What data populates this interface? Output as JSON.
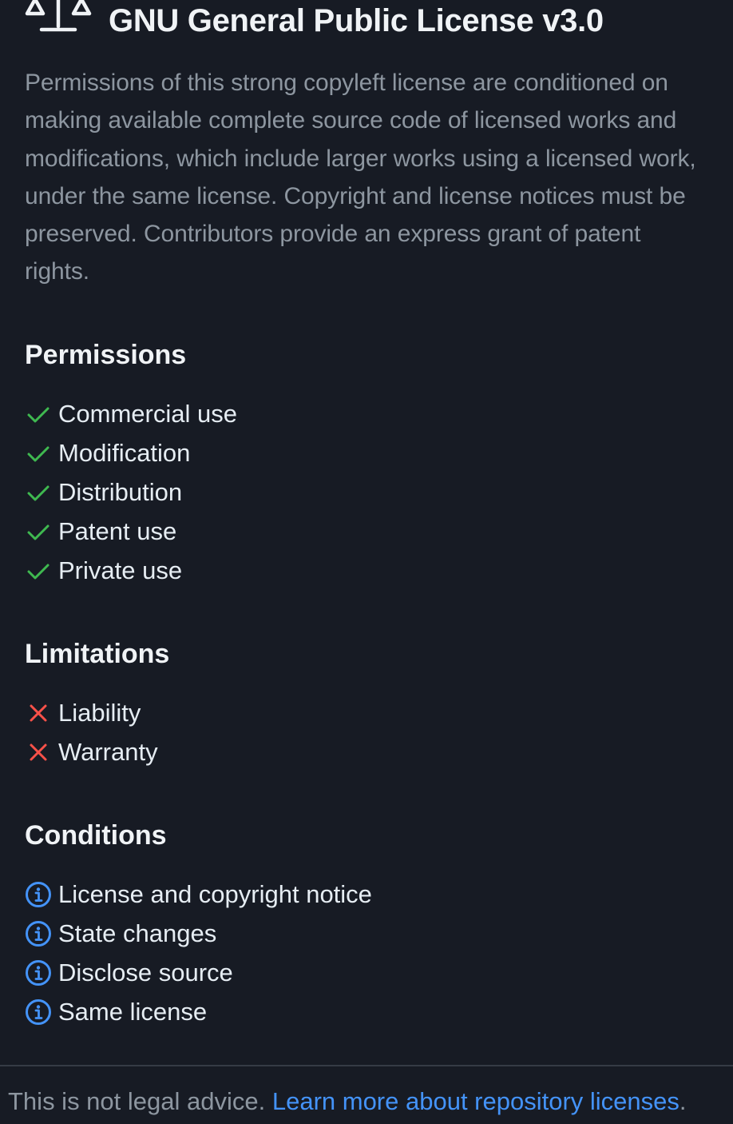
{
  "license": {
    "icon": "law-icon",
    "title": "GNU General Public License v3.0",
    "description": "Permissions of this strong copyleft license are conditioned on making available complete source code of licensed works and modifications, which include larger works using a licensed work, under the same license. Copyright and license notices must be preserved. Contributors provide an express grant of patent rights."
  },
  "permissions": {
    "heading": "Permissions",
    "icon": "check-icon",
    "color": "#3fb950",
    "items": [
      "Commercial use",
      "Modification",
      "Distribution",
      "Patent use",
      "Private use"
    ]
  },
  "limitations": {
    "heading": "Limitations",
    "icon": "x-icon",
    "color": "#f85149",
    "items": [
      "Liability",
      "Warranty"
    ]
  },
  "conditions": {
    "heading": "Conditions",
    "icon": "info-icon",
    "color": "#4493f8",
    "items": [
      "License and copyright notice",
      "State changes",
      "Disclose source",
      "Same license"
    ]
  },
  "footer": {
    "text": "This is not legal advice.",
    "link_text": "Learn more about repository licenses",
    "trailing": "."
  }
}
